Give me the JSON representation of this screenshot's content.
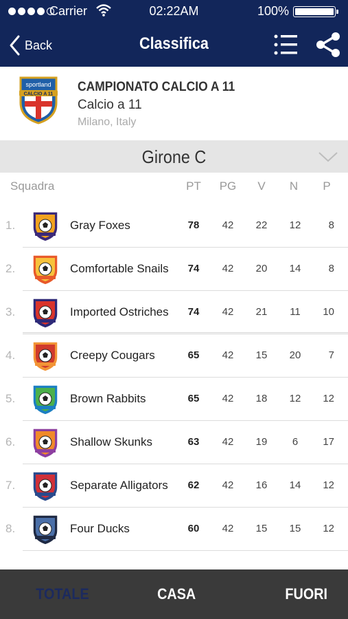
{
  "status_bar": {
    "carrier": "Carrier",
    "time": "02:22AM",
    "battery": "100%",
    "battery_level": 1.0
  },
  "nav": {
    "back_label": "Back",
    "title": "Classifica",
    "icons": [
      "chevron-left-icon",
      "list-icon",
      "share-icon"
    ]
  },
  "league": {
    "badge_text": "sportland",
    "badge_sub": "CALCIO A 11",
    "name": "CAMPIONATO CALCIO A 11",
    "subtitle": "Calcio a 11",
    "location": "Milano, Italy"
  },
  "group": {
    "title": "Girone C"
  },
  "columns": {
    "team": "Squadra",
    "pt": "PT",
    "pg": "PG",
    "v": "V",
    "n": "N",
    "p": "P"
  },
  "standings": [
    {
      "rank": "1.",
      "team": "Gray Foxes",
      "pt": "78",
      "pg": "42",
      "v": "22",
      "n": "12",
      "p": "8",
      "crest": "purple-shield-crest",
      "crest_colors": [
        "#3c2a78",
        "#f2a21e"
      ]
    },
    {
      "rank": "2.",
      "team": "Comfortable Snails",
      "pt": "74",
      "pg": "42",
      "v": "20",
      "n": "14",
      "p": "8",
      "crest": "orange-shield-crest",
      "crest_colors": [
        "#e85a2a",
        "#f7c23c"
      ]
    },
    {
      "rank": "3.",
      "team": "Imported Ostriches",
      "pt": "74",
      "pg": "42",
      "v": "21",
      "n": "11",
      "p": "10",
      "crest": "football-champions-crest",
      "crest_colors": [
        "#2e2a78",
        "#d9342b"
      ]
    },
    {
      "rank": "4.",
      "team": "Creepy Cougars",
      "pt": "65",
      "pg": "42",
      "v": "15",
      "n": "20",
      "p": "7",
      "crest": "fc-united-orange-crest",
      "crest_colors": [
        "#f29436",
        "#d03a2c"
      ]
    },
    {
      "rank": "5.",
      "team": "Brown Rabbits",
      "pt": "65",
      "pg": "42",
      "v": "18",
      "n": "12",
      "p": "12",
      "crest": "soccer-green-crest",
      "crest_colors": [
        "#1c7fc2",
        "#4bb04b"
      ]
    },
    {
      "rank": "6.",
      "team": "Shallow Skunks",
      "pt": "63",
      "pg": "42",
      "v": "19",
      "n": "6",
      "p": "17",
      "crest": "purple-orange-crest",
      "crest_colors": [
        "#8d3fa0",
        "#f08a2a"
      ]
    },
    {
      "rank": "7.",
      "team": "Separate Alligators",
      "pt": "62",
      "pg": "42",
      "v": "16",
      "n": "14",
      "p": "12",
      "crest": "fc-united-red-crest",
      "crest_colors": [
        "#2a4a8c",
        "#d02f38"
      ]
    },
    {
      "rank": "8.",
      "team": "Four Ducks",
      "pt": "60",
      "pg": "42",
      "v": "15",
      "n": "15",
      "p": "12",
      "crest": "soccer-club-dark-crest",
      "crest_colors": [
        "#1f2a44",
        "#4a6fa8"
      ]
    }
  ],
  "tabs": {
    "totale": "TOTALE",
    "casa": "CASA",
    "fuori": "FUORI",
    "active": "totale"
  },
  "colors": {
    "header": "#12265a",
    "tabbar": "#3a3a3a",
    "group_bar": "#e5e5e5"
  }
}
